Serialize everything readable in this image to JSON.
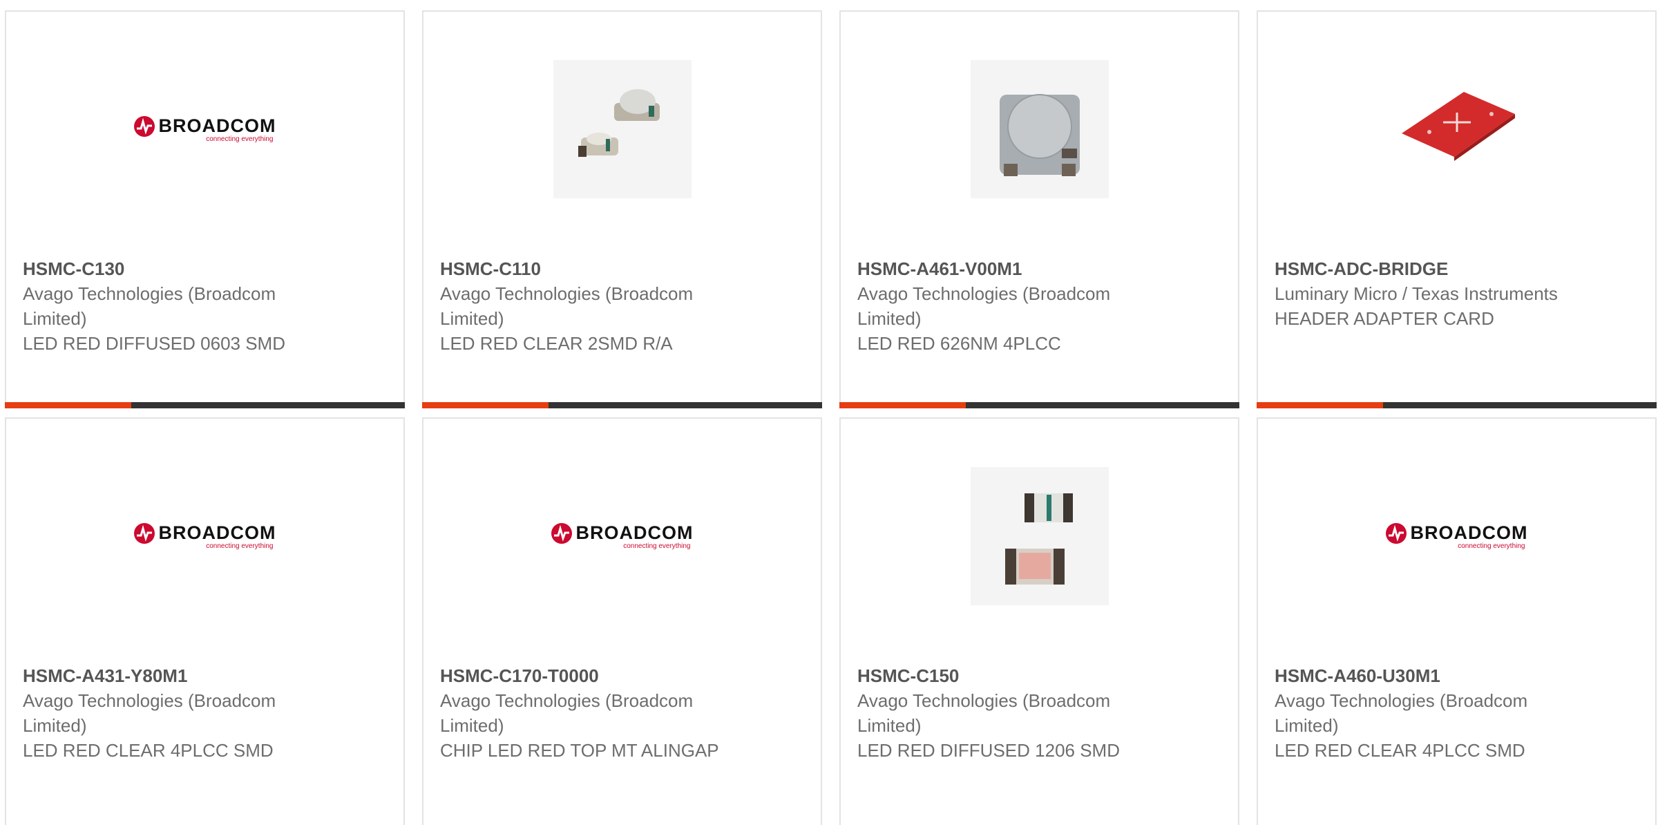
{
  "products": [
    {
      "part_number": "HSMC-C130",
      "manufacturer": "Avago Technologies (Broadcom Limited)",
      "description": "LED RED DIFFUSED 0603 SMD",
      "image": "broadcom-logo"
    },
    {
      "part_number": "HSMC-C110",
      "manufacturer": "Avago Technologies (Broadcom Limited)",
      "description": "LED RED CLEAR 2SMD R/A",
      "image": "right-angle-led-photo"
    },
    {
      "part_number": "HSMC-A461-V00M1",
      "manufacturer": "Avago Technologies (Broadcom Limited)",
      "description": "LED RED 626NM 4PLCC",
      "image": "plcc-dome-led-photo"
    },
    {
      "part_number": "HSMC-ADC-BRIDGE",
      "manufacturer": "Luminary Micro / Texas Instruments",
      "description": "HEADER ADAPTER CARD",
      "image": "red-pcb-board-photo"
    },
    {
      "part_number": "HSMC-A431-Y80M1",
      "manufacturer": "Avago Technologies (Broadcom Limited)",
      "description": "LED RED CLEAR 4PLCC SMD",
      "image": "broadcom-logo"
    },
    {
      "part_number": "HSMC-C170-T0000",
      "manufacturer": "Avago Technologies (Broadcom Limited)",
      "description": "CHIP LED RED TOP MT ALINGAP",
      "image": "broadcom-logo"
    },
    {
      "part_number": "HSMC-C150",
      "manufacturer": "Avago Technologies (Broadcom Limited)",
      "description": "LED RED DIFFUSED 1206 SMD",
      "image": "chip-led-1206-photo"
    },
    {
      "part_number": "HSMC-A460-U30M1",
      "manufacturer": "Avago Technologies (Broadcom Limited)",
      "description": "LED RED CLEAR 4PLCC SMD",
      "image": "broadcom-logo"
    }
  ],
  "logo": {
    "brand": "BROADCOM",
    "tagline": "connecting everything"
  },
  "colors": {
    "accent": "#e63e12",
    "bar": "#333333",
    "border": "#e3e3e3",
    "brand_red": "#cc092f",
    "text": "#6d6d6d"
  }
}
